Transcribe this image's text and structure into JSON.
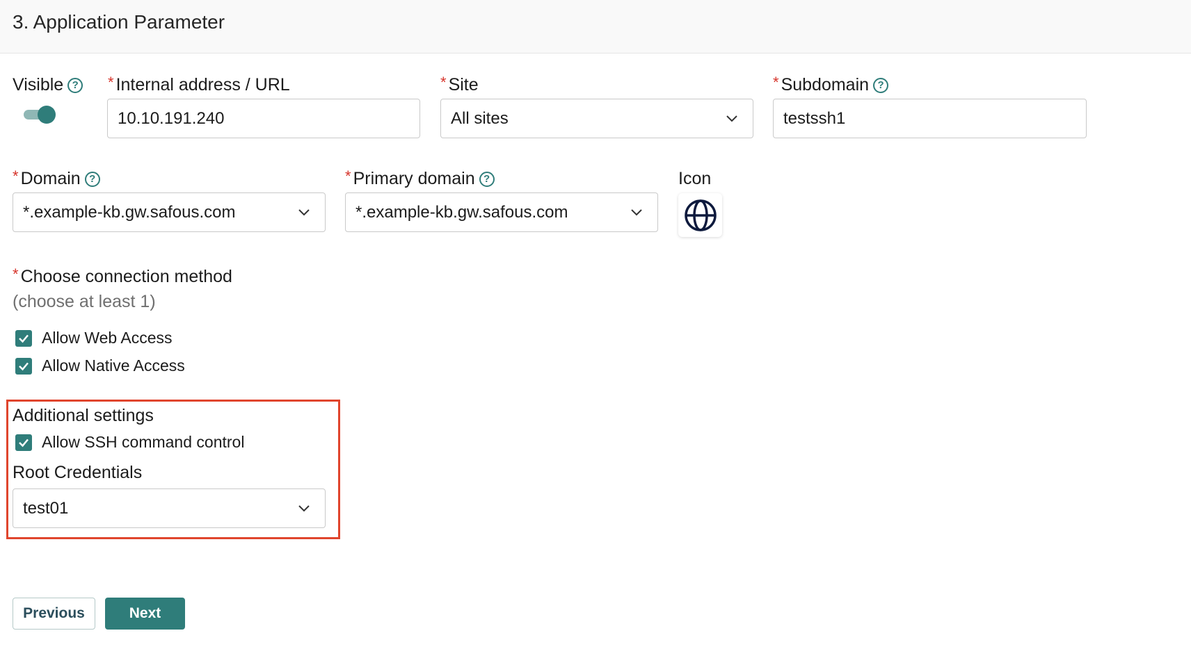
{
  "header": {
    "title": "3. Application Parameter"
  },
  "visible": {
    "label": "Visible",
    "help": "?",
    "enabled": true
  },
  "internal_address": {
    "required": "*",
    "label": "Internal address / URL",
    "value": "10.10.191.240"
  },
  "site": {
    "required": "*",
    "label": "Site",
    "value": "All sites"
  },
  "subdomain": {
    "required": "*",
    "label": "Subdomain",
    "help": "?",
    "value": "testssh1"
  },
  "domain": {
    "required": "*",
    "label": "Domain",
    "help": "?",
    "value": "*.example-kb.gw.safous.com"
  },
  "primary_domain": {
    "required": "*",
    "label": "Primary domain",
    "help": "?",
    "value": "*.example-kb.gw.safous.com"
  },
  "icon": {
    "label": "Icon",
    "icon_name": "globe-icon"
  },
  "connection": {
    "required": "*",
    "label": "Choose connection method",
    "hint": "(choose at least 1)",
    "options": [
      {
        "label": "Allow Web Access",
        "checked": true
      },
      {
        "label": "Allow Native Access",
        "checked": true
      }
    ]
  },
  "additional": {
    "title": "Additional settings",
    "ssh_control": {
      "label": "Allow SSH command control",
      "checked": true
    },
    "root_credentials": {
      "label": "Root Credentials",
      "value": "test01"
    }
  },
  "buttons": {
    "previous": "Previous",
    "next": "Next"
  },
  "colors": {
    "accent": "#2f7d7a",
    "required": "#d6342b",
    "highlight": "#e0452d"
  }
}
